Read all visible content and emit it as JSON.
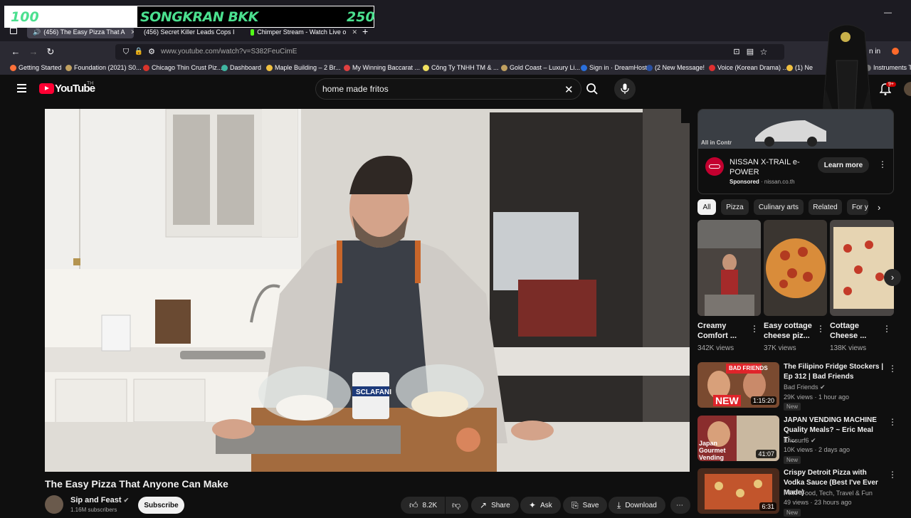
{
  "overlay": {
    "left_num": "100",
    "title": "SONGKRAN BKK",
    "right_num": "250"
  },
  "browser": {
    "tabs": [
      {
        "label": "(456) The Easy Pizza That A",
        "color": "#ff0033"
      },
      {
        "label": "(456) Secret Killer Leads Cops I",
        "color": "#ff0033"
      },
      {
        "label": "Chimper Stream - Watch Live o",
        "color": "#53fc18"
      }
    ],
    "new_tab": "+",
    "url": "www.youtube.com/watch?v=S382FeuCimE",
    "sign_in": "n in",
    "bookmarks": [
      {
        "label": "Getting Started",
        "color": "#ff7139"
      },
      {
        "label": "Foundation (2021) S0...",
        "color": "#c0a060"
      },
      {
        "label": "Chicago Thin Crust Piz...",
        "color": "#d9342b"
      },
      {
        "label": "Dashboard",
        "color": "#3fb5a0"
      },
      {
        "label": "Maple Building – 2 Br...",
        "color": "#f0c040"
      },
      {
        "label": "My Winning Baccarat ...",
        "color": "#e04040"
      },
      {
        "label": "Công Ty TNHH TM & ...",
        "color": "#f0e060"
      },
      {
        "label": "Gold Coast – Luxury Li...",
        "color": "#c0a060"
      },
      {
        "label": "Sign in · DreamHost",
        "color": "#2a6fdb"
      },
      {
        "label": "(2 New Message!",
        "color": "#2a50a0"
      },
      {
        "label": "Voice (Korean Drama) ...",
        "color": "#e03030"
      },
      {
        "label": "(1) Ne",
        "color": "#f0c040"
      },
      {
        "label": "Instruments T",
        "color": "#777777"
      }
    ]
  },
  "youtube": {
    "logo": "YouTube",
    "logo_sup": "TH",
    "search_query": "home made fritos",
    "notif_count": "9+",
    "ad": {
      "banner_text": "All in Contr",
      "title": "NISSAN X-TRAIL e-POWER",
      "sponsored": "Sponsored",
      "domain": "nissan.co.th",
      "cta": "Learn more"
    },
    "chips": [
      "All",
      "Pizza",
      "Culinary arts",
      "Related",
      "For y"
    ],
    "shorts": [
      {
        "title": "Creamy Comfort ...",
        "views": "342K views"
      },
      {
        "title": "Easy cottage cheese piz...",
        "views": "37K views"
      },
      {
        "title": "Cottage Cheese ...",
        "views": "138K views"
      }
    ],
    "recs": [
      {
        "title": "The Filipino Fridge Stockers | Ep 312 | Bad Friends",
        "channel": "Bad Friends",
        "meta": "29K views · 1 hour ago",
        "badge": "New",
        "duration": "1:15:20",
        "thumb_badge": "NEW",
        "thumb_text": "BAD FRIENDS"
      },
      {
        "title": "JAPAN VENDING MACHINE Quality Meals? ~ Eric Meal Ti...",
        "channel": "Ericsurf6",
        "meta": "10K views · 2 days ago",
        "badge": "New",
        "duration": "41:07",
        "thumb_text": "Japan Gourmet Vending"
      },
      {
        "title": "Crispy Detroit Pizza with Vodka Sauce (Best I've Ever Made)",
        "channel": "FTTF Food, Tech, Travel & Fun",
        "meta": "49 views · 23 hours ago",
        "badge": "New",
        "duration": "6:31"
      }
    ],
    "video": {
      "title": "The Easy Pizza That Anyone Can Make",
      "channel": "Sip and Feast",
      "subs": "1.16M subscribers",
      "subscribe": "Subscribe",
      "likes": "8.2K",
      "share": "Share",
      "ask": "Ask",
      "save": "Save",
      "download": "Download",
      "can_label": "SCLAFANI"
    }
  }
}
